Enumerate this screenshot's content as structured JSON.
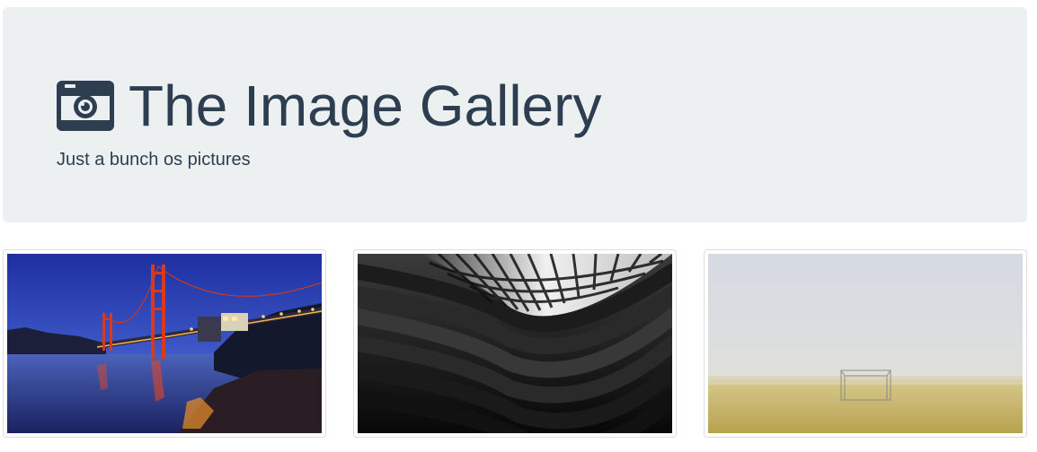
{
  "header": {
    "title": "The Image Gallery",
    "subtitle": "Just a bunch os pictures",
    "icon": "camera-icon"
  },
  "gallery": {
    "items": [
      {
        "name": "golden-gate-bridge-image"
      },
      {
        "name": "abstract-architecture-image"
      },
      {
        "name": "foggy-field-image"
      }
    ]
  },
  "colors": {
    "text": "#2c3e50",
    "jumbotron_bg": "#ecf0f1",
    "thumb_border": "#dddddd"
  }
}
